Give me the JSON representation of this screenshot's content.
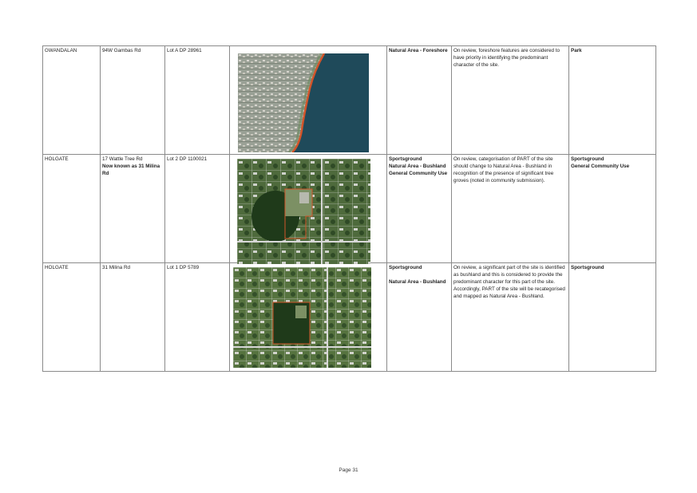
{
  "rows": [
    {
      "suburb": "GWANDALAN",
      "address": "94W Gambas Rd",
      "address_note": "",
      "lot": "Lot A DP 28961",
      "categories": [
        "Natural Area - Foreshore"
      ],
      "comment": "On review, foreshore features are considered to have priority in identifying the predominant character of the site.",
      "outcome": [
        "Park"
      ]
    },
    {
      "suburb": "HOLGATE",
      "address": "17 Wattle Tree Rd",
      "address_note": "Now known as 31 Milina Rd",
      "lot": "Lot 2 DP 1100021",
      "categories": [
        "Sportsground",
        "Natural Area - Bushland",
        "General Community Use"
      ],
      "comment": "On review, categorisation of PART of the site should change to Natural Area - Bushland in recognition of the presence of significant tree groves (noted in community submission).",
      "outcome": [
        "Sportsground",
        "General Community Use"
      ]
    },
    {
      "suburb": "HOLGATE",
      "address": "31 Milina Rd",
      "address_note": "",
      "lot": "Lot 1 DP 5789",
      "categories": [
        "Sportsground",
        "Natural Area - Bushland"
      ],
      "comment": "On review, a significant part of the site is identified as bushland and this is considered to provide the predominant character for this part of the site. Accordingly, PART of the site will be recategorised and mapped as Natural Area - Bushland.",
      "outcome": [
        "Sportsground"
      ]
    }
  ],
  "footer": {
    "page": "Page 31"
  },
  "colors": {
    "border": "#8a8a8a",
    "boundary": "#d2552a",
    "water": "#1f4a5a"
  }
}
